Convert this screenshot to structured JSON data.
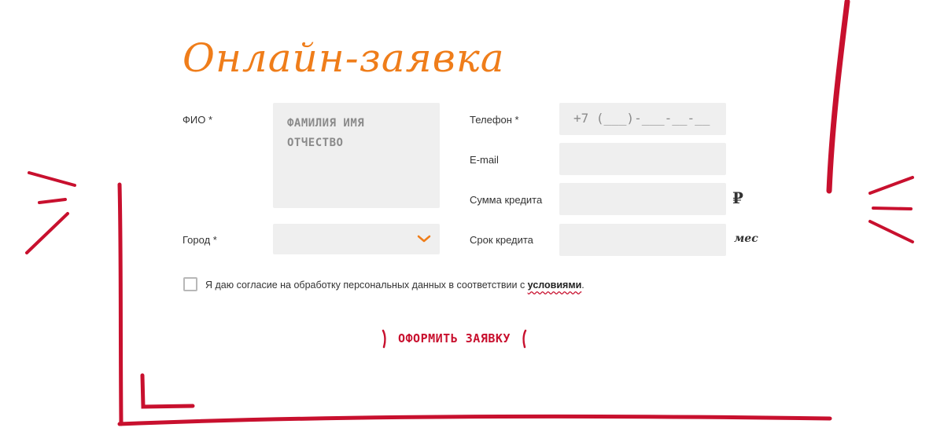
{
  "title": "Онлайн-заявка",
  "form": {
    "fio": {
      "label": "ФИО *",
      "placeholder": "ФАМИЛИЯ ИМЯ ОТЧЕСТВО"
    },
    "city": {
      "label": "Город *",
      "value": ""
    },
    "phone": {
      "label": "Телефон *",
      "placeholder": "+7 (___)-___-__-__"
    },
    "email": {
      "label": "E-mail",
      "placeholder": ""
    },
    "sum": {
      "label": "Сумма кредита",
      "unit": "₽"
    },
    "term": {
      "label": "Срок кредита",
      "unit": "мес"
    }
  },
  "consent": {
    "text": "Я даю согласие на обработку персональных данных в соответствии с ",
    "link": "условиями",
    "end": "."
  },
  "submit": {
    "label": "ОФОРМИТЬ ЗАЯВКУ"
  },
  "colors": {
    "accent_orange": "#ef7d1a",
    "brand_red": "#c8102e",
    "field_bg": "#efefef"
  },
  "icons": {
    "select": "chevron-down-icon"
  }
}
